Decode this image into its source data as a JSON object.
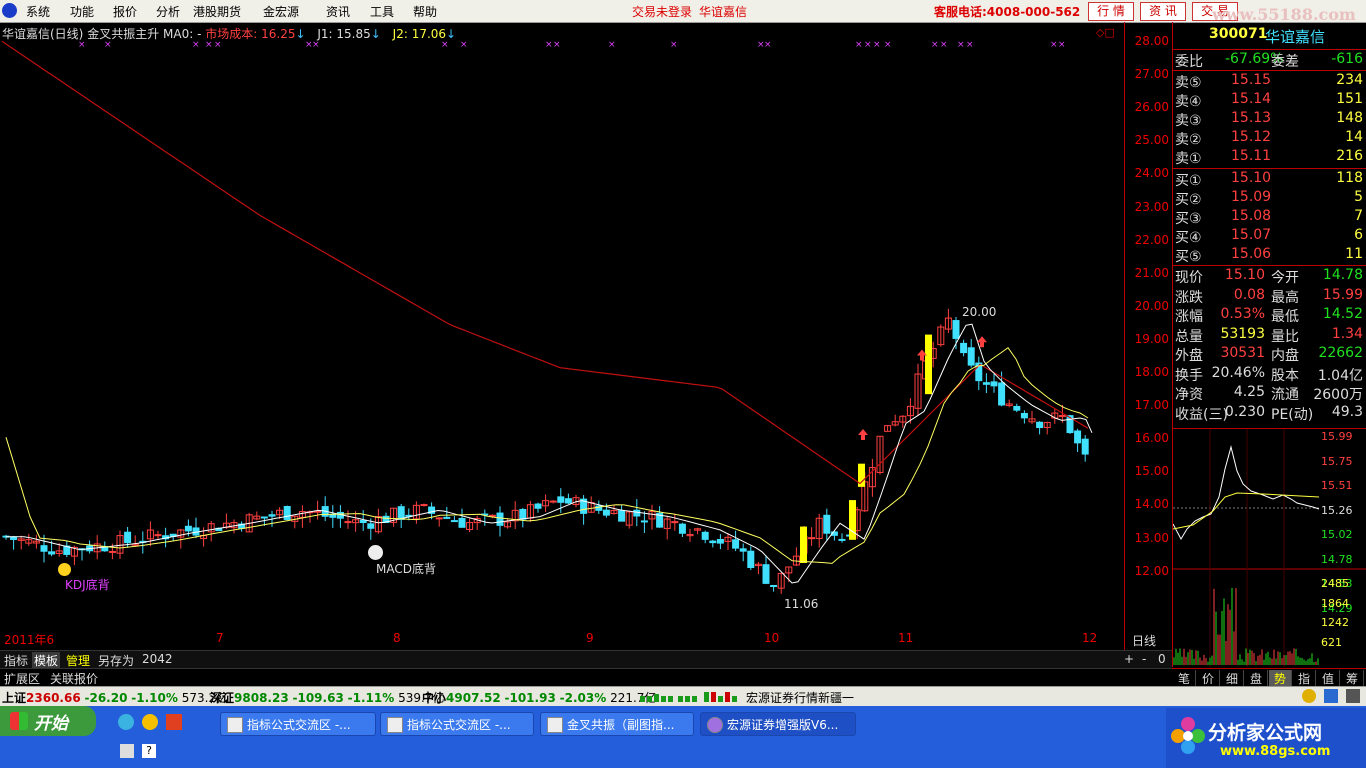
{
  "menu": {
    "items": [
      "系统",
      "功能",
      "报价",
      "分析",
      "港股期货",
      "金宏源",
      "资讯",
      "工具",
      "帮助"
    ],
    "trade_status": "交易未登录",
    "stock_name": "华谊嘉信",
    "hotline": "客服电话:4008-000-562",
    "buttons": [
      "行 情",
      "资 讯",
      "交 易"
    ],
    "watermark": "www.55188.com"
  },
  "chart": {
    "title": "华谊嘉信(日线)",
    "indicator": "金叉共振主升",
    "ma0": "MA0: -",
    "cost_label": "市场成本: 16.25",
    "j1": "J1: 15.85",
    "j2": "J2: 17.06",
    "annotations": {
      "kdj": "KDJ底背",
      "macd": "MACD底背",
      "high": "20.00",
      "low": "11.06"
    },
    "x_labels": [
      "2011年6",
      "7",
      "8",
      "9",
      "10",
      "11",
      "12"
    ],
    "y_ticks": [
      "28.00",
      "27.00",
      "26.00",
      "25.00",
      "24.00",
      "23.00",
      "22.00",
      "21.00",
      "20.00",
      "19.00",
      "18.00",
      "17.00",
      "16.00",
      "15.00",
      "14.00",
      "13.00",
      "12.00"
    ],
    "colors": {
      "up": "#ff4040",
      "down": "#40e0ff",
      "cost_line": "#c01010",
      "ma_white": "#ffffff",
      "ma_yellow": "#ffff60",
      "signal": "#ffff00"
    }
  },
  "quote": {
    "code": "300071",
    "name": "华谊嘉信",
    "weibi_label": "委比",
    "weibi": "-67.69%",
    "weicha_label": "委差",
    "weicha": "-616",
    "asks": [
      {
        "label": "卖⑤",
        "price": "15.15",
        "vol": "234"
      },
      {
        "label": "卖④",
        "price": "15.14",
        "vol": "151"
      },
      {
        "label": "卖③",
        "price": "15.13",
        "vol": "148"
      },
      {
        "label": "卖②",
        "price": "15.12",
        "vol": "14"
      },
      {
        "label": "卖①",
        "price": "15.11",
        "vol": "216"
      }
    ],
    "bids": [
      {
        "label": "买①",
        "price": "15.10",
        "vol": "118"
      },
      {
        "label": "买②",
        "price": "15.09",
        "vol": "5"
      },
      {
        "label": "买③",
        "price": "15.08",
        "vol": "7"
      },
      {
        "label": "买④",
        "price": "15.07",
        "vol": "6"
      },
      {
        "label": "买⑤",
        "price": "15.06",
        "vol": "11"
      }
    ],
    "stats": [
      {
        "l1": "现价",
        "v1": "15.10",
        "l2": "今开",
        "v2": "14.78",
        "c1": "c-red",
        "c2": "c-grn"
      },
      {
        "l1": "涨跌",
        "v1": "0.08",
        "l2": "最高",
        "v2": "15.99",
        "c1": "c-red",
        "c2": "c-red"
      },
      {
        "l1": "涨幅",
        "v1": "0.53%",
        "l2": "最低",
        "v2": "14.52",
        "c1": "c-red",
        "c2": "c-grn"
      },
      {
        "l1": "总量",
        "v1": "53193",
        "l2": "量比",
        "v2": "1.34",
        "c1": "c-yel",
        "c2": "c-red"
      },
      {
        "l1": "外盘",
        "v1": "30531",
        "l2": "内盘",
        "v2": "22662",
        "c1": "c-red",
        "c2": "c-grn"
      },
      {
        "l1": "换手",
        "v1": "20.46%",
        "l2": "股本",
        "v2": "1.04亿",
        "c1": "c-wht",
        "c2": "c-wht"
      },
      {
        "l1": "净资",
        "v1": "4.25",
        "l2": "流通",
        "v2": "2600万",
        "c1": "c-wht",
        "c2": "c-wht"
      },
      {
        "l1": "收益(三)",
        "v1": "0.230",
        "l2": "PE(动)",
        "v2": "49.3",
        "c1": "c-wht",
        "c2": "c-wht"
      }
    ]
  },
  "mini": {
    "price_ticks": [
      "15.99",
      "15.75",
      "15.51",
      "15.26",
      "15.02",
      "14.78",
      "14.53",
      "14.29"
    ],
    "vol_ticks": [
      "2485",
      "1864",
      "1242",
      "621"
    ],
    "tabs": [
      "笔",
      "价",
      "细",
      "盘",
      "势",
      "指",
      "值",
      "筹"
    ],
    "active_tab": "势"
  },
  "toolbar": {
    "items": [
      "指标",
      "模板",
      "管理",
      "另存为",
      "2042"
    ],
    "right": [
      "+",
      "-",
      "0"
    ],
    "line_label": "日线",
    "ext": [
      "扩展区",
      "关联报价"
    ]
  },
  "status": {
    "sh": {
      "name": "上证",
      "val": "2360.66",
      "chg": "-26.20",
      "pct": "-1.10%",
      "amt": "573.2亿"
    },
    "sz": {
      "name": "深证",
      "val": "9808.23",
      "chg": "-109.63",
      "pct": "-1.11%",
      "amt": "539.7亿"
    },
    "zx": {
      "name": "中小",
      "val": "4907.52",
      "chg": "-101.93",
      "pct": "-2.03%",
      "amt": "221.7亿"
    },
    "broker": "宏源证券行情新疆一"
  },
  "taskbar": {
    "start": "开始",
    "tasks": [
      "指标公式交流区 -...",
      "指标公式交流区 -...",
      "金叉共振（副图指...",
      "宏源证券增强版V6..."
    ],
    "brand": "分析家公式网",
    "brand_url": "www.88gs.com"
  }
}
